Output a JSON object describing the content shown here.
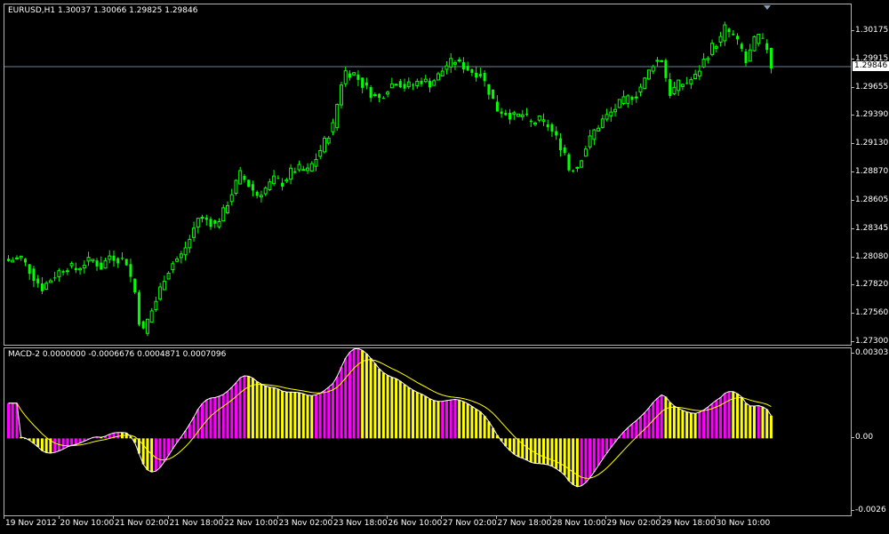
{
  "price_pane": {
    "header": {
      "symbol": "EURUSD,H1",
      "ohlc": "1.30037 1.30066 1.29825 1.29846"
    },
    "price_labels": [
      "1.30175",
      "1.29915",
      "1.29655",
      "1.29390",
      "1.29130",
      "1.28870",
      "1.28605",
      "1.28345",
      "1.28080",
      "1.27820",
      "1.27560",
      "1.27300"
    ],
    "bid_price": "1.29846",
    "candle_up_color": "#00ff00",
    "candle_down_color": "#00ff00",
    "bid_line_color": "#708090"
  },
  "macd_pane": {
    "header": {
      "name": "MACD-2",
      "values": "0.0000000 -0.0006676 0.0004871 0.0007096"
    },
    "scale_labels": [
      "0.0030375",
      "0.00",
      "-0.0026"
    ],
    "histogram_colors": {
      "up": "#ff00ff",
      "down": "#ffff00"
    },
    "line_colors": {
      "macd": "#ffffff",
      "signal": "#ffff00"
    }
  },
  "time_axis": {
    "labels": [
      "19 Nov 2012",
      "20 Nov 10:00",
      "21 Nov 02:00",
      "21 Nov 18:00",
      "22 Nov 10:00",
      "23 Nov 02:00",
      "23 Nov 18:00",
      "26 Nov 10:00",
      "27 Nov 02:00",
      "27 Nov 18:00",
      "28 Nov 10:00",
      "29 Nov 02:00",
      "29 Nov 18:00",
      "30 Nov 10:00"
    ]
  },
  "chart_data": [
    {
      "type": "line",
      "title": "EURUSD,H1",
      "subtitle": "1.30037 1.30066 1.29825 1.29846",
      "x": [
        "19 Nov 2012",
        "20 Nov 10:00",
        "21 Nov 02:00",
        "21 Nov 18:00",
        "22 Nov 10:00",
        "23 Nov 02:00",
        "23 Nov 18:00",
        "26 Nov 10:00",
        "27 Nov 02:00",
        "27 Nov 18:00",
        "28 Nov 10:00",
        "29 Nov 02:00",
        "29 Nov 18:00",
        "30 Nov 10:00"
      ],
      "close_path": [
        [
          0,
          1.2805
        ],
        [
          3,
          1.2808
        ],
        [
          6,
          1.279
        ],
        [
          8,
          1.278
        ],
        [
          10,
          1.2788
        ],
        [
          12,
          1.2795
        ],
        [
          14,
          1.28
        ],
        [
          16,
          1.2797
        ],
        [
          18,
          1.2803
        ],
        [
          20,
          1.2806
        ],
        [
          22,
          1.2799
        ],
        [
          24,
          1.281
        ],
        [
          26,
          1.2807
        ],
        [
          28,
          1.2804
        ],
        [
          30,
          1.2776
        ],
        [
          31,
          1.275
        ],
        [
          32,
          1.274
        ],
        [
          33,
          1.275
        ],
        [
          35,
          1.2768
        ],
        [
          37,
          1.279
        ],
        [
          39,
          1.2803
        ],
        [
          41,
          1.281
        ],
        [
          43,
          1.2825
        ],
        [
          45,
          1.2845
        ],
        [
          47,
          1.2843
        ],
        [
          49,
          1.2838
        ],
        [
          51,
          1.285
        ],
        [
          53,
          1.2868
        ],
        [
          55,
          1.2885
        ],
        [
          57,
          1.2875
        ],
        [
          59,
          1.2866
        ],
        [
          61,
          1.2872
        ],
        [
          63,
          1.288
        ],
        [
          65,
          1.2877
        ],
        [
          67,
          1.2887
        ],
        [
          69,
          1.289
        ],
        [
          71,
          1.2888
        ],
        [
          73,
          1.29
        ],
        [
          75,
          1.2915
        ],
        [
          77,
          1.293
        ],
        [
          78,
          1.295
        ],
        [
          79,
          1.297
        ],
        [
          80,
          1.298
        ],
        [
          82,
          1.2978
        ],
        [
          84,
          1.2968
        ],
        [
          86,
          1.296
        ],
        [
          88,
          1.2955
        ],
        [
          90,
          1.2965
        ],
        [
          92,
          1.2972
        ],
        [
          94,
          1.2966
        ],
        [
          96,
          1.2968
        ],
        [
          98,
          1.2972
        ],
        [
          100,
          1.2969
        ],
        [
          102,
          1.2976
        ],
        [
          104,
          1.2986
        ],
        [
          106,
          1.299
        ],
        [
          108,
          1.2985
        ],
        [
          110,
          1.298
        ],
        [
          112,
          1.2978
        ],
        [
          114,
          1.2962
        ],
        [
          116,
          1.2945
        ],
        [
          118,
          1.2942
        ],
        [
          120,
          1.2938
        ],
        [
          122,
          1.294
        ],
        [
          124,
          1.2932
        ],
        [
          126,
          1.2935
        ],
        [
          128,
          1.293
        ],
        [
          130,
          1.2918
        ],
        [
          132,
          1.2905
        ],
        [
          133,
          1.289
        ],
        [
          135,
          1.2893
        ],
        [
          137,
          1.291
        ],
        [
          139,
          1.2925
        ],
        [
          141,
          1.2935
        ],
        [
          143,
          1.2942
        ],
        [
          145,
          1.295
        ],
        [
          147,
          1.2955
        ],
        [
          149,
          1.296
        ],
        [
          151,
          1.2972
        ],
        [
          153,
          1.2988
        ],
        [
          155,
          1.2992
        ],
        [
          156,
          1.2975
        ],
        [
          157,
          1.296
        ],
        [
          159,
          1.2968
        ],
        [
          161,
          1.297
        ],
        [
          163,
          1.2975
        ],
        [
          165,
          1.299
        ],
        [
          167,
          1.3003
        ],
        [
          169,
          1.301
        ],
        [
          170,
          1.302
        ],
        [
          172,
          1.3012
        ],
        [
          174,
          1.3
        ],
        [
          175,
          1.2988
        ],
        [
          177,
          1.3008
        ],
        [
          178,
          1.3012
        ],
        [
          180,
          1.3002
        ],
        [
          181,
          1.2985
        ]
      ],
      "ylim": [
        1.273,
        1.3026
      ]
    },
    {
      "type": "bar",
      "title": "MACD-2",
      "subtitle": "0.0000000 -0.0006676 0.0004871 0.0007096",
      "ylim": [
        -0.0026,
        0.0030375
      ]
    }
  ]
}
